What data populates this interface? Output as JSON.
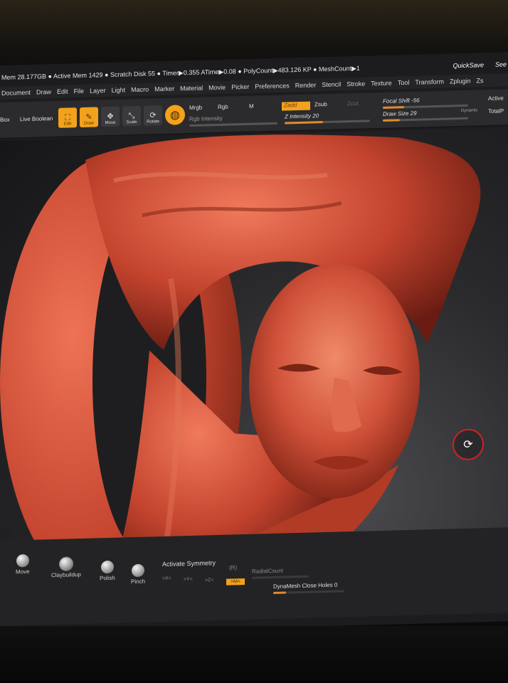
{
  "status": {
    "text": "Mem 28.177GB ● Active Mem 1429 ● Scratch Disk 55 ● Timer▶0.355 ATime▶0.08 ● PolyCount▶483.126 KP ● MeshCount▶1",
    "quicksave": "QuickSave",
    "see": "See"
  },
  "menu": [
    "Document",
    "Draw",
    "Edit",
    "File",
    "Layer",
    "Light",
    "Macro",
    "Marker",
    "Material",
    "Movie",
    "Picker",
    "Preferences",
    "Render",
    "Stencil",
    "Stroke",
    "Texture",
    "Tool",
    "Transform",
    "Zplugin",
    "Zs"
  ],
  "toolbar": {
    "box": "Box",
    "live_boolean": "Live Boolean",
    "edit": "Edit",
    "draw": "Draw",
    "move": "Move",
    "scale": "Scale",
    "rotate": "Rotate",
    "mrgb": "Mrgb",
    "rgb": "Rgb",
    "m": "M",
    "rgb_intensity": "Rgb Intensity",
    "zadd": "Zadd",
    "zsub": "Zsub",
    "zcut": "Zcut",
    "z_intensity": "Z Intensity 20",
    "focal_shift": "Focal Shift -56",
    "draw_size": "Draw Size 29",
    "dynamic": "Dynamic",
    "active": "Active",
    "total": "TotalP"
  },
  "shelf": {
    "brushes": [
      "Move",
      "Claybuildup",
      "Polish",
      "Pinch"
    ],
    "activate_symmetry": "Activate Symmetry",
    "x": ">X<",
    "y": ">Y<",
    "z": ">Z<",
    "m": ">M<",
    "r": "(R)",
    "radial_count": "RadialCount",
    "dynamesh": "DynaMesh Close Holes 0"
  },
  "colors": {
    "accent": "#f2a21c",
    "clay": "#c4442e",
    "highlight_ring": "#d42020"
  }
}
